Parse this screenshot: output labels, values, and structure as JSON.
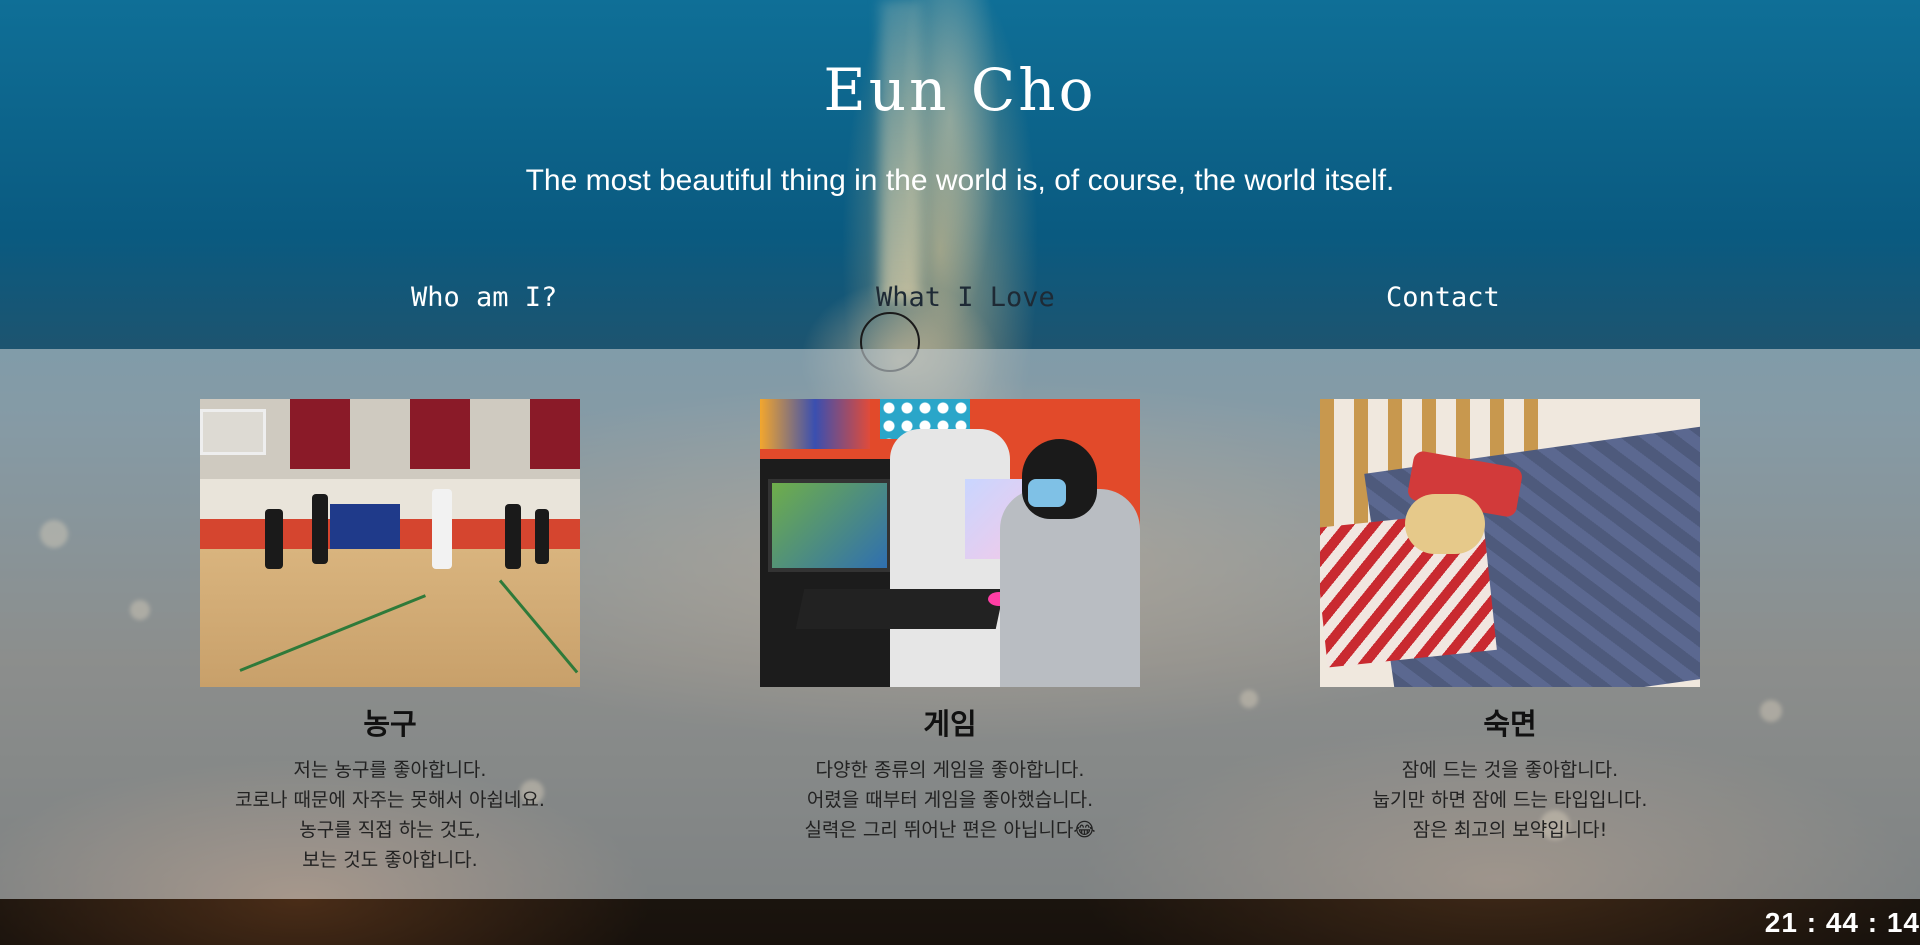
{
  "header": {
    "title": "Eun Cho",
    "tagline": "The most beautiful thing in the world is, of course, the world itself."
  },
  "nav": {
    "items": [
      {
        "label": "Who am I?"
      },
      {
        "label": "What I Love"
      },
      {
        "label": "Contact"
      }
    ],
    "active_index": 1
  },
  "loves": [
    {
      "title": "농구",
      "lines": [
        "저는 농구를 좋아합니다.",
        "코로나 때문에 자주는 못해서 아쉽네요.",
        "농구를 직접 하는 것도,",
        "보는 것도 좋아합니다."
      ]
    },
    {
      "title": "게임",
      "lines": [
        "다양한 종류의 게임을 좋아합니다.",
        "어렸을 때부터 게임을 좋아했습니다.",
        "실력은 그리 뛰어난 편은 아닙니다😂"
      ]
    },
    {
      "title": "숙면",
      "lines": [
        "잠에 드는 것을 좋아합니다.",
        "눕기만 하면 잠에 드는 타입입니다.",
        "잠은 최고의 보약입니다!"
      ]
    }
  ],
  "footer": {
    "clock": "21 : 44 : 14"
  },
  "colors": {
    "nav_active": "#1e2a35",
    "panel_overlay": "rgba(190,200,205,0.62)"
  }
}
